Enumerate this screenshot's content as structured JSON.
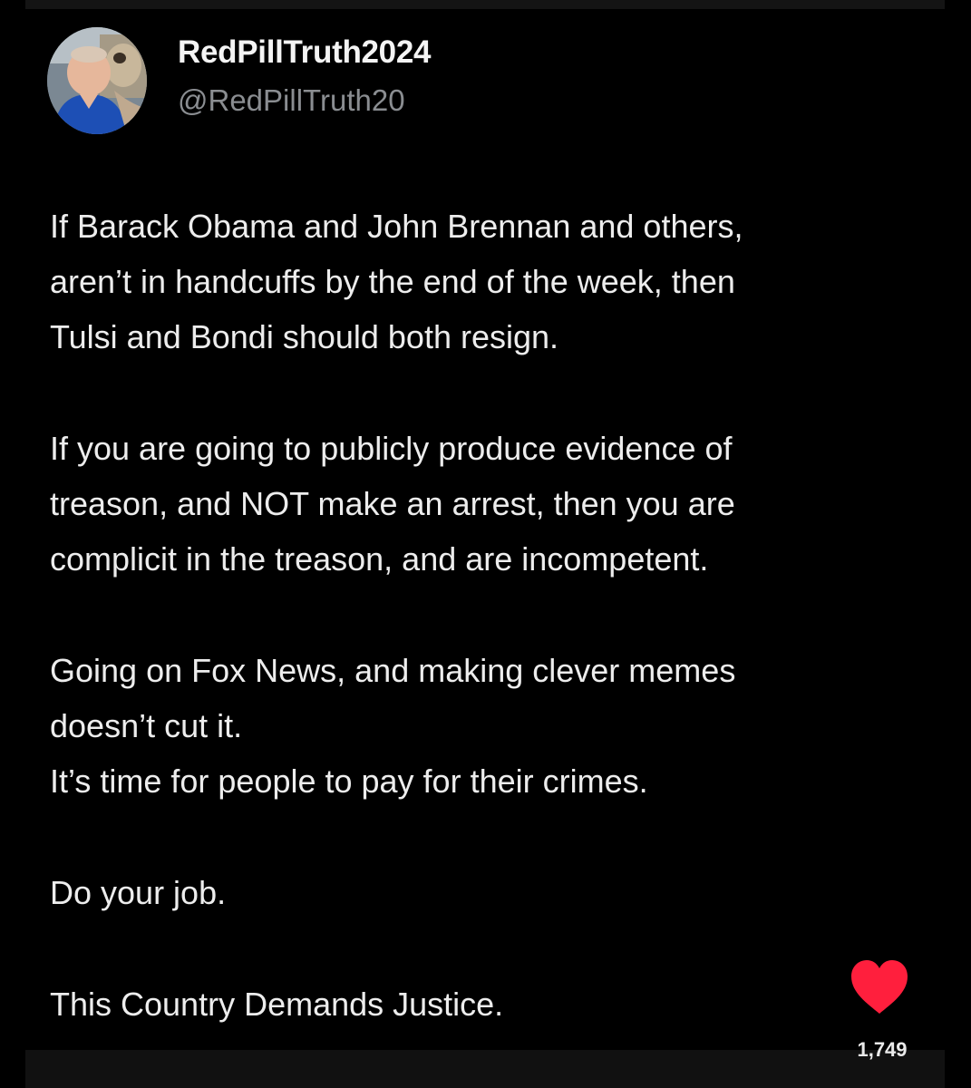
{
  "post": {
    "display_name": "RedPillTruth2024",
    "handle": "@RedPillTruth20",
    "avatar_icon": "profile-photo",
    "paragraphs": [
      {
        "lines": [
          "If Barack Obama and John Brennan and others,",
          "aren’t in handcuffs by the end of the week, then",
          "Tulsi and Bondi should both resign."
        ]
      },
      {
        "lines": [
          "If you are going to publicly produce evidence of",
          "treason, and NOT make an arrest, then you are",
          "complicit in the treason, and are incompetent."
        ]
      },
      {
        "lines": [
          "Going on Fox News, and making clever memes",
          "doesn’t cut it.",
          "It’s time for people to pay for their crimes."
        ]
      },
      {
        "lines": [
          "Do your job."
        ]
      },
      {
        "lines": [
          "This Country Demands Justice."
        ]
      }
    ]
  },
  "reaction": {
    "icon": "heart-icon",
    "count": "1,749",
    "color": "#ff1f3d"
  },
  "colors": {
    "background": "#000000",
    "text": "#ededed",
    "handle": "#8a8d91"
  }
}
